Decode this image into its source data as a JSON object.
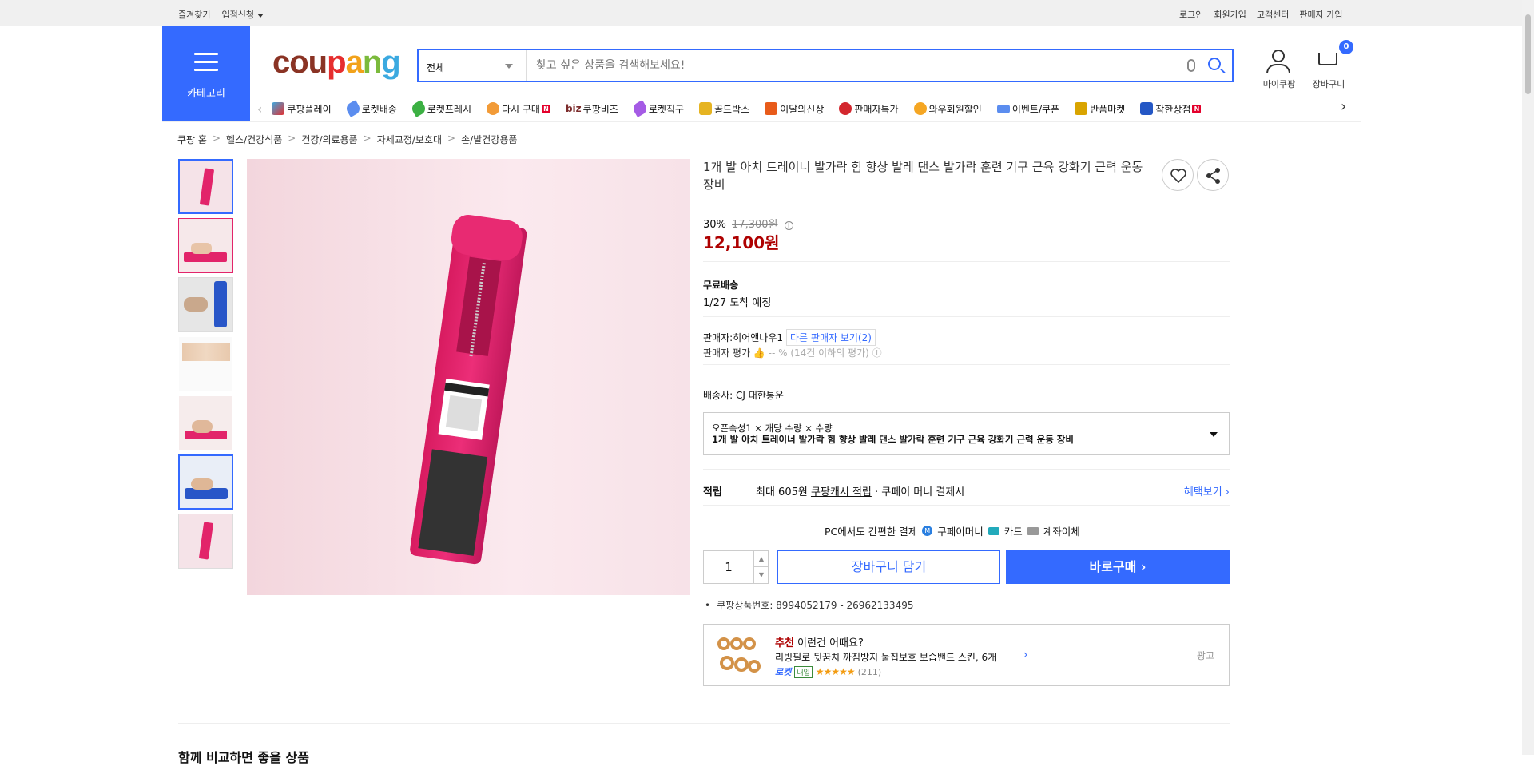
{
  "topbar": {
    "favorites": "즐겨찾기",
    "apply": "입점신청",
    "login": "로그인",
    "signup": "회원가입",
    "support": "고객센터",
    "seller_join": "판매자 가입"
  },
  "category": {
    "label": "카테고리"
  },
  "logo": {
    "p1": "cou",
    "p2": "p",
    "p3": "a",
    "p4": "n",
    "p5": "g"
  },
  "search": {
    "scope": "전체",
    "placeholder": "찾고 싶은 상품을 검색해보세요!"
  },
  "account": {
    "my": "마이쿠팡",
    "cart": "장바구니",
    "cart_count": "0"
  },
  "nav": {
    "items": [
      "쿠팡플레이",
      "로켓배송",
      "로켓프레시",
      "다시 구매",
      "biz",
      "쿠팡비즈",
      "로켓직구",
      "골드박스",
      "이달의신상",
      "판매자특가",
      "와우회원할인",
      "이벤트/쿠폰",
      "반품마켓",
      "착한상점"
    ],
    "badge": "N"
  },
  "breadcrumb": [
    "쿠팡 홈",
    "헬스/건강식품",
    "건강/의료용품",
    "자세교정/보호대",
    "손/발건강용품"
  ],
  "product": {
    "title": "1개 발 아치 트레이너 발가락 힘 향상 발레 댄스 발가락 훈련 기구 근육 강화기 근력 운동 장비",
    "discount": "30%",
    "original_price": "17,300원",
    "info": "i",
    "price": "12,100원",
    "shipping_label": "무료배송",
    "arrival": "1/27 도착 예정",
    "seller_prefix": "판매자:",
    "seller_name": "히어앤나우1",
    "other_sellers": "다른 판매자 보기(2)",
    "seller_rating_label": "판매자 평가",
    "seller_rating_value": "-- % (14건 이하의 평가)",
    "carrier": "배송사:  CJ 대한통운",
    "option_line1": "오픈속성1 × 개당 수량 × 수량",
    "option_line2": "1개 발 아치 트레이너 발가락 힘 향상 발레 댄스 발가락 훈련 기구 근육 강화기 근력 운동 장비",
    "reward_label": "적립",
    "reward_text1": "최대 605원 ",
    "reward_text2": "쿠팡캐시 적립",
    "reward_text3": " · 쿠페이 머니 결제시",
    "reward_more": "혜택보기 ›",
    "pay_title": "PC에서도 간편한 결제",
    "pay_money": "쿠페이머니",
    "pay_card": "카드",
    "pay_account": "계좌이체",
    "quantity": "1",
    "add_cart": "장바구니 담기",
    "buy_now": "바로구매 ›",
    "product_number": "쿠팡상품번호: 8994052179 - 26962133495"
  },
  "recommend": {
    "tag": "추천",
    "title": " 이런건 어때요?",
    "name": "리빙필로 뒷꿈치 까짐방지 물집보호 보습밴드 스킨, 6개",
    "rocket": "로켓",
    "next_day": "내일",
    "stars": "★★★★★",
    "count": "(211)",
    "ad": "광고"
  },
  "footer": {
    "heading": "함께 비교하면 좋을 상품"
  },
  "colors": {
    "accent": "#346aff",
    "price": "#ae0000"
  }
}
